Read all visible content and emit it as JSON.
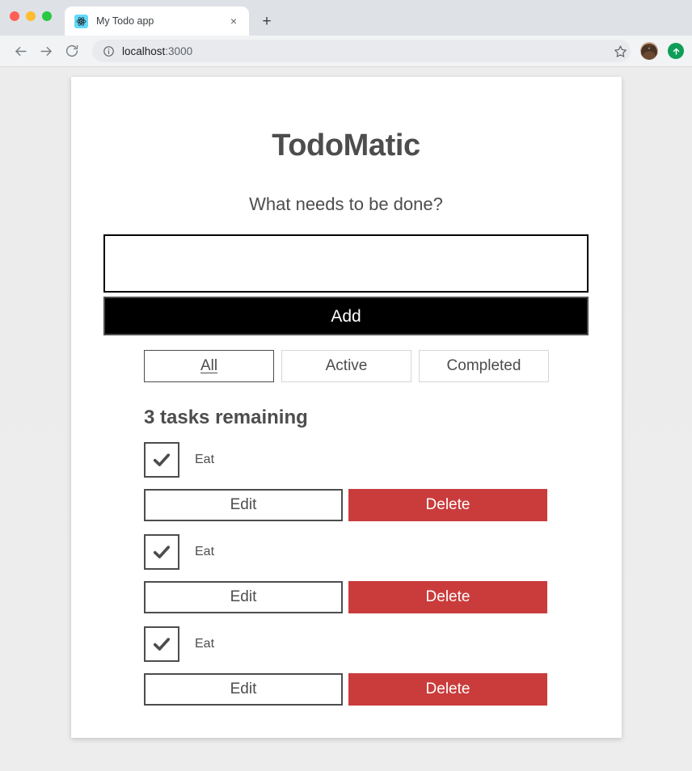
{
  "browser": {
    "traffic_lights": [
      "close",
      "minimize",
      "maximize"
    ],
    "tab": {
      "title": "My Todo app",
      "favicon": "react-logo-icon",
      "close_label": "×"
    },
    "new_tab_label": "+",
    "nav": {
      "back": "back-arrow-icon",
      "forward": "forward-arrow-icon",
      "reload": "reload-icon"
    },
    "omnibox": {
      "info_icon": "info-circle-icon",
      "host": "localhost",
      "port": ":3000",
      "full_url": "localhost:3000"
    },
    "actions": {
      "bookmark": "star-icon",
      "profile": "avatar",
      "update": "update-arrow-icon"
    },
    "colors": {
      "tabstrip": "#dee1e6",
      "toolbar": "#f1f3f4",
      "omnibox": "#e8eaed",
      "favicon_bg": "#61dafb",
      "update_green": "#0f9d58"
    }
  },
  "page": {
    "title": "TodoMatic",
    "form": {
      "label": "What needs to be done?",
      "input_value": "",
      "input_placeholder": "",
      "add_label": "Add"
    },
    "filters": [
      {
        "label": "All",
        "selected": true
      },
      {
        "label": "Active",
        "selected": false
      },
      {
        "label": "Completed",
        "selected": false
      }
    ],
    "list_heading": "3 tasks remaining",
    "remaining_count": 3,
    "todos": [
      {
        "label": "Eat",
        "checked": true,
        "edit_label": "Edit",
        "delete_label": "Delete"
      },
      {
        "label": "Eat",
        "checked": true,
        "edit_label": "Edit",
        "delete_label": "Delete"
      },
      {
        "label": "Eat",
        "checked": true,
        "edit_label": "Edit",
        "delete_label": "Delete"
      }
    ],
    "colors": {
      "text": "#4d4d4d",
      "add_button_bg": "#000000",
      "delete_button_bg": "#ca3c3c",
      "card_bg": "#ffffff",
      "page_bg": "#ececec"
    }
  }
}
